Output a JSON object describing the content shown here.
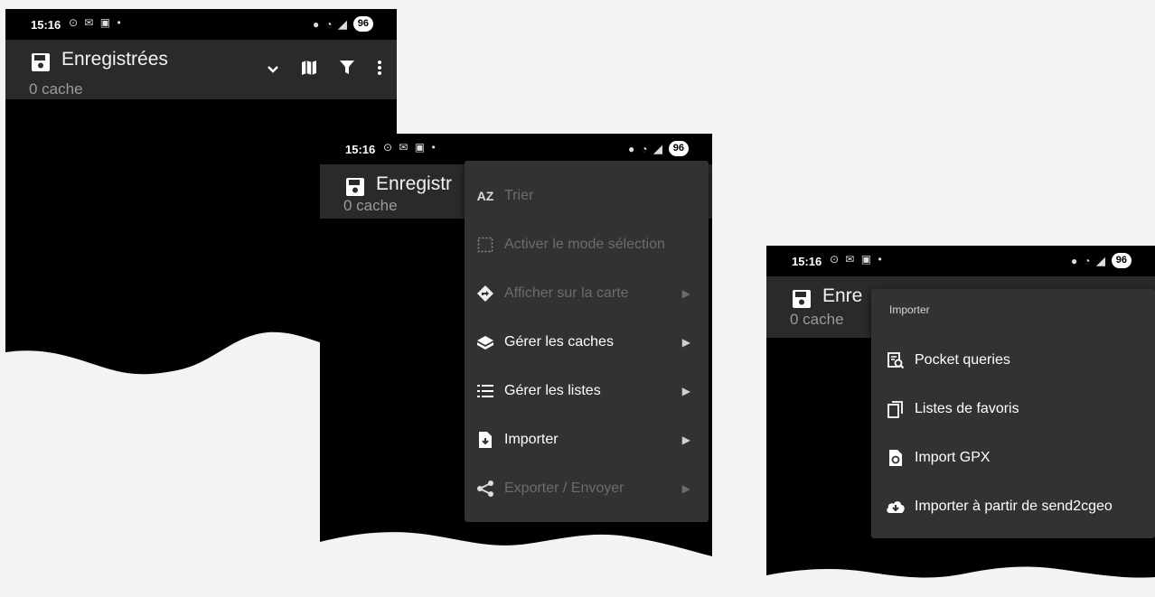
{
  "status": {
    "time": "15:16",
    "battery": "96"
  },
  "screen1": {
    "title": "Enregistrées",
    "subtitle": "0 cache"
  },
  "screen2": {
    "title": "Enregistr",
    "subtitle": "0 cache",
    "menu": [
      {
        "label": "Trier",
        "icon": "sort-az-icon",
        "enabled": false,
        "submenu": false
      },
      {
        "label": "Activer le mode sélection",
        "icon": "selection-icon",
        "enabled": false,
        "submenu": false
      },
      {
        "label": "Afficher sur la carte",
        "icon": "directions-icon",
        "enabled": false,
        "submenu": true
      },
      {
        "label": "Gérer les caches",
        "icon": "cache-icon",
        "enabled": true,
        "submenu": true
      },
      {
        "label": "Gérer les listes",
        "icon": "list-icon",
        "enabled": true,
        "submenu": true
      },
      {
        "label": "Importer",
        "icon": "import-file-icon",
        "enabled": true,
        "submenu": true
      },
      {
        "label": "Exporter / Envoyer",
        "icon": "share-icon",
        "enabled": false,
        "submenu": true
      }
    ]
  },
  "screen3": {
    "title": "Enre",
    "subtitle": "0 cache",
    "menu_header": "Importer",
    "menu": [
      {
        "label": "Pocket queries",
        "icon": "pocket-query-icon"
      },
      {
        "label": "Listes de favoris",
        "icon": "bookmark-list-icon"
      },
      {
        "label": "Import GPX",
        "icon": "gpx-file-icon"
      },
      {
        "label": "Importer à partir de send2cgeo",
        "icon": "cloud-download-icon"
      }
    ]
  }
}
